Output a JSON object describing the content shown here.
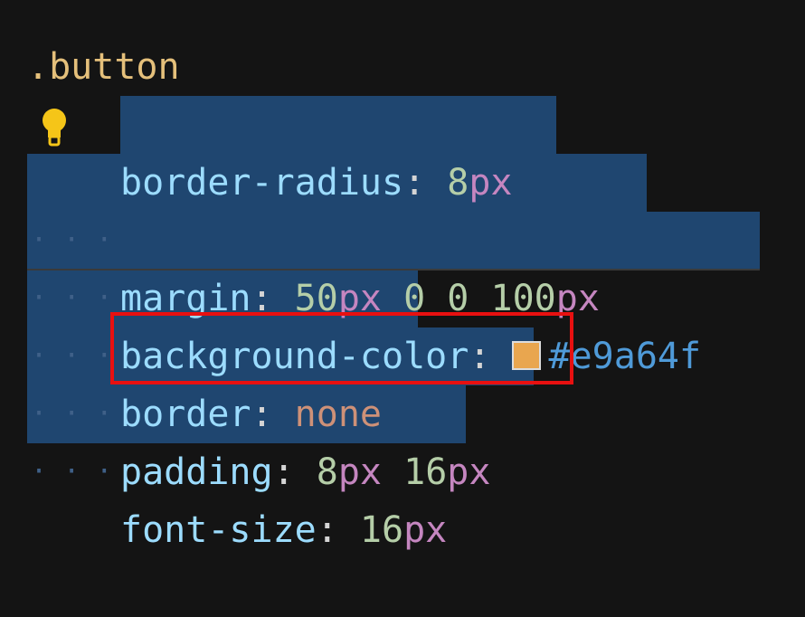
{
  "selector": ".button",
  "declarations": [
    {
      "property": "border-radius",
      "values": [
        {
          "num": "8",
          "unit": "px"
        }
      ]
    },
    {
      "property": "margin",
      "values": [
        {
          "num": "50",
          "unit": "px"
        },
        {
          "num": "0",
          "unit": ""
        },
        {
          "num": "0",
          "unit": ""
        },
        {
          "num": "100",
          "unit": "px"
        }
      ]
    },
    {
      "property": "background-color",
      "color": "#e9a64f",
      "hex": "#e9a64f"
    },
    {
      "property": "border",
      "keyword": "none"
    },
    {
      "property": "padding",
      "values": [
        {
          "num": "8",
          "unit": "px"
        },
        {
          "num": "16",
          "unit": "px"
        }
      ]
    },
    {
      "property": "font-size",
      "values": [
        {
          "num": "16",
          "unit": "px"
        }
      ]
    }
  ],
  "highlighted_line": "padding",
  "icons": {
    "lightbulb": "lightbulb-icon"
  },
  "colors": {
    "background": "#141414",
    "selection": "#1f4670",
    "highlight_box": "#e81010",
    "swatch": "#e9a64f"
  }
}
